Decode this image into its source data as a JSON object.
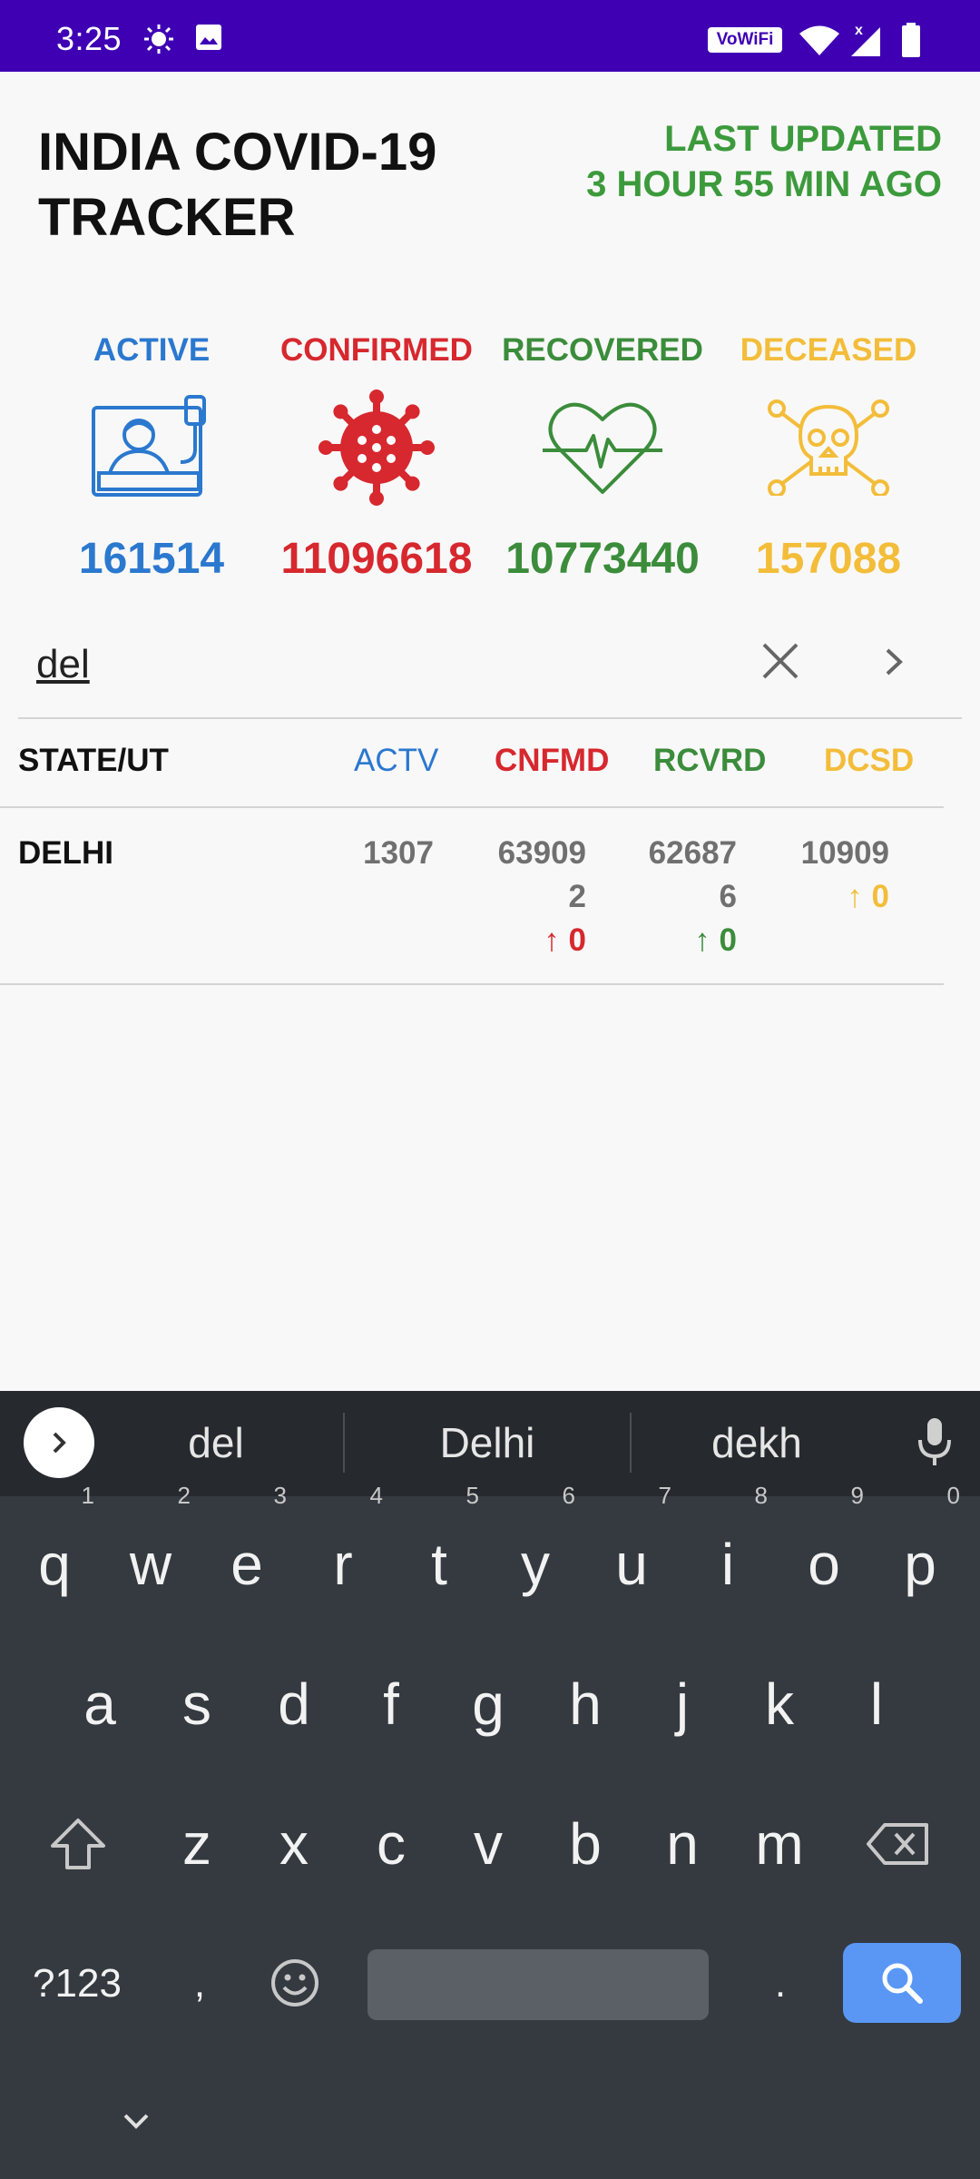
{
  "status_bar": {
    "time": "3:25",
    "icons": [
      "weather-sun-icon",
      "image-icon",
      "vowifi-icon",
      "wifi-icon",
      "signal-icon",
      "battery-icon"
    ],
    "vowifi_label": "VoWiFi"
  },
  "header": {
    "title_line1": "INDIA COVID-19",
    "title_line2": "TRACKER",
    "updated_line1": "LAST UPDATED",
    "updated_line2": "3 HOUR 55 MIN AGO"
  },
  "stats": {
    "active": {
      "label": "ACTIVE",
      "value": "161514",
      "color": "#2b78cf"
    },
    "confirmed": {
      "label": "CONFIRMED",
      "value": "11096618",
      "color": "#d6282e"
    },
    "recovered": {
      "label": "RECOVERED",
      "value": "10773440",
      "color": "#3b8c3b"
    },
    "deceased": {
      "label": "DECEASED",
      "value": "157088",
      "color": "#f3bd3a"
    }
  },
  "search": {
    "value": "del"
  },
  "table": {
    "headers": {
      "state": "STATE/UT",
      "active": "ACTV",
      "confirmed": "CNFMD",
      "recovered": "RCVRD",
      "deceased": "DCSD"
    },
    "rows": [
      {
        "state": "DELHI",
        "active": "1307",
        "confirmed_line1": "63909",
        "confirmed_line2": "2",
        "confirmed_delta": "↑ 0",
        "recovered_line1": "62687",
        "recovered_line2": "6",
        "recovered_delta": "↑ 0",
        "deceased": "10909",
        "deceased_delta": "↑ 0"
      }
    ]
  },
  "keyboard": {
    "suggestions": [
      "del",
      "Delhi",
      "dekh"
    ],
    "row1": [
      {
        "k": "q",
        "n": "1"
      },
      {
        "k": "w",
        "n": "2"
      },
      {
        "k": "e",
        "n": "3"
      },
      {
        "k": "r",
        "n": "4"
      },
      {
        "k": "t",
        "n": "5"
      },
      {
        "k": "y",
        "n": "6"
      },
      {
        "k": "u",
        "n": "7"
      },
      {
        "k": "i",
        "n": "8"
      },
      {
        "k": "o",
        "n": "9"
      },
      {
        "k": "p",
        "n": "0"
      }
    ],
    "row2": [
      "a",
      "s",
      "d",
      "f",
      "g",
      "h",
      "j",
      "k",
      "l"
    ],
    "row3": [
      "z",
      "x",
      "c",
      "v",
      "b",
      "n",
      "m"
    ],
    "symbols_key": "?123",
    "comma_key": ",",
    "period_key": "."
  }
}
